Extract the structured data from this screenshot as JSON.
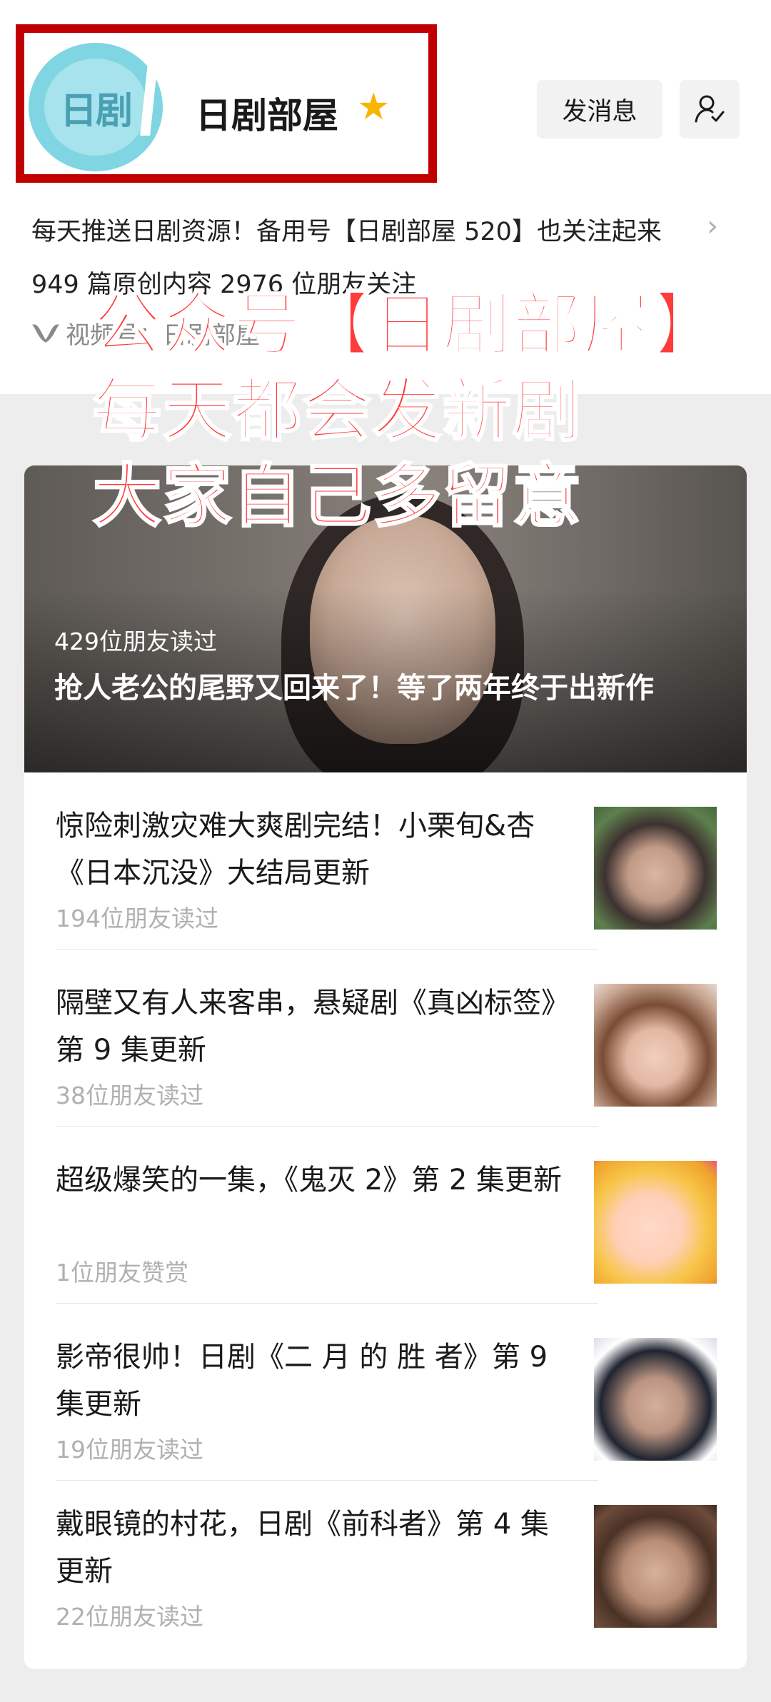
{
  "header": {
    "avatar_text": "日剧",
    "account_name": "日剧部屋",
    "message_button": "发消息",
    "description": "每天推送日剧资源！备用号【日剧部屋 520】也关注起来",
    "stats": "949 篇原创内容  2976 位朋友关注",
    "channel_text": "视频号：日剧部屋"
  },
  "overlay": {
    "line1": "公众号【日剧部屋】",
    "line2": "每天都会发新剧",
    "line3": "大家自己多留意"
  },
  "featured": {
    "reads": "429位朋友读过",
    "title": "抢人老公的尾野又回来了！等了两年终于出新作"
  },
  "articles": [
    {
      "title": "惊险刺激灾难大爽剧完结！小栗旬&杏《日本沉没》大结局更新",
      "meta": "194位朋友读过"
    },
    {
      "title": "隔壁又有人来客串，悬疑剧《真凶标签》第 9 集更新",
      "meta": "38位朋友读过"
    },
    {
      "title": "超级爆笑的一集，《鬼灭 2》第 2 集更新",
      "meta": "1位朋友赞赏"
    },
    {
      "title": "影帝很帅！日剧《二 月 的 胜 者》第 9 集更新",
      "meta": "19位朋友读过"
    },
    {
      "title": "戴眼镜的村花，日剧《前科者》第 4 集更新",
      "meta": "22位朋友读过"
    }
  ],
  "colors": {
    "highlight_border": "#c00000",
    "overlay_text": "#ff3b3b",
    "star": "#f7b500",
    "avatar": "#7fd5e1"
  }
}
